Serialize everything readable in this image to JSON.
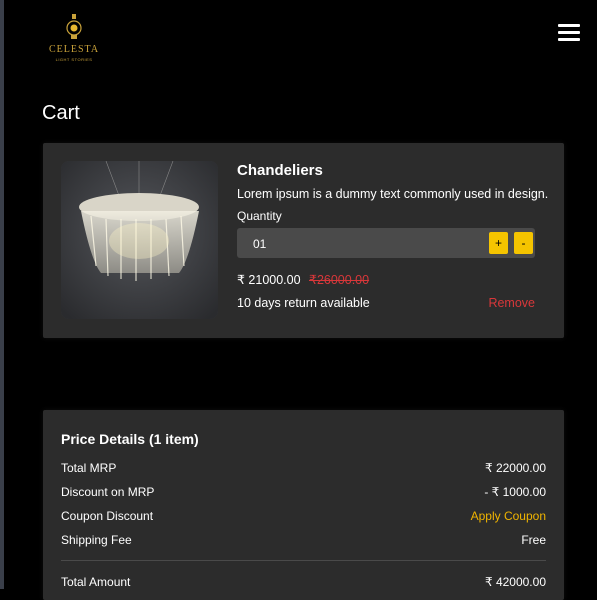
{
  "header": {
    "brand": "CELESTA",
    "tagline": "LIGHT STORIES",
    "menu_icon": "hamburger-menu-icon"
  },
  "page": {
    "title": "Cart"
  },
  "cart": {
    "item": {
      "name": "Chandeliers",
      "description": "Lorem ipsum is a dummy text commonly used in design.",
      "quantity_label": "Quantity",
      "quantity_value": "01",
      "plus_label": "+",
      "minus_label": "-",
      "price": "₹ 21000.00",
      "original_price": "₹26000.00",
      "return_text": "10 days return available",
      "remove_label": "Remove"
    }
  },
  "price_details": {
    "title": "Price Details (1 item)",
    "rows": [
      {
        "label": "Total MRP",
        "value": "₹ 22000.00"
      },
      {
        "label": "Discount on MRP",
        "value": "- ₹ 1000.00"
      },
      {
        "label": "Coupon Discount",
        "value": "Apply Coupon"
      },
      {
        "label": "Shipping Fee",
        "value": "Free"
      }
    ],
    "total_label": "Total Amount",
    "total_value": "₹ 42000.00"
  },
  "colors": {
    "background": "#000000",
    "card": "#2c2c2c",
    "accent_yellow": "#f5c400",
    "remove_red": "#d8373a",
    "coupon_gold": "#f0b400"
  }
}
